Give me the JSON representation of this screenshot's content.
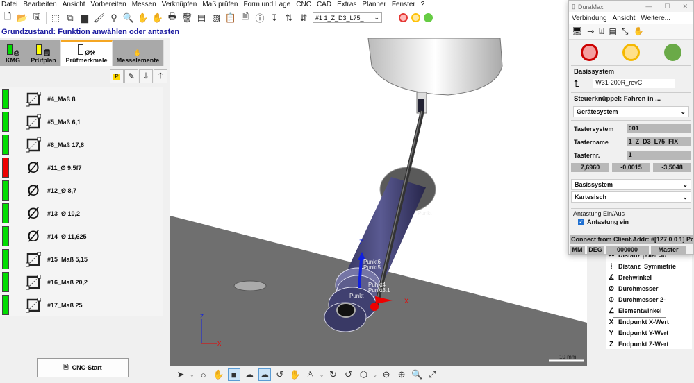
{
  "menu": [
    "Datei",
    "Bearbeiten",
    "Ansicht",
    "Vorbereiten",
    "Messen",
    "Verknüpfen",
    "Maß prüfen",
    "Form und Lage",
    "CNC",
    "CAD",
    "Extras",
    "Planner",
    "Fenster",
    "?"
  ],
  "toolbar": {
    "probe_select": "#1      1_Z_D3_L75_",
    "lights": [
      "#e53935",
      "#ffc107",
      "#4caf50"
    ]
  },
  "status_line": "Grundzustand: Funktion anwählen oder antasten",
  "left_tabs": [
    {
      "label": "KMG",
      "indicator": "#00dd00"
    },
    {
      "label": "Prüfplan",
      "indicator": "#ffff00"
    },
    {
      "label": "Prüfmerkmale",
      "indicator": "#ffffff"
    },
    {
      "label": "Messelemente"
    }
  ],
  "mini_toolbar": {
    "p_label": "P"
  },
  "features": [
    {
      "label": "#4_Maß 8",
      "status": "#00dd00",
      "icon": "distance"
    },
    {
      "label": "#5_Maß 6,1",
      "status": "#00dd00",
      "icon": "distance"
    },
    {
      "label": "#8_Maß 17,8",
      "status": "#00dd00",
      "icon": "distance"
    },
    {
      "label": "#11_Ø 9,5f7",
      "status": "#ee0000",
      "icon": "diameter"
    },
    {
      "label": "#12_Ø 8,7",
      "status": "#00dd00",
      "icon": "diameter"
    },
    {
      "label": "#13_Ø 10,2",
      "status": "#00dd00",
      "icon": "diameter"
    },
    {
      "label": "#14_Ø 11,625",
      "status": "#00dd00",
      "icon": "diameter"
    },
    {
      "label": "#15_Maß 5,15",
      "status": "#00dd00",
      "icon": "distance"
    },
    {
      "label": "#16_Maß 20,2",
      "status": "#00dd00",
      "icon": "distance"
    },
    {
      "label": "#17_Maß 25",
      "status": "#00dd00",
      "icon": "distance"
    }
  ],
  "cnc_start": "CNC-Start",
  "viewport": {
    "labels": {
      "punkt_top": "Punkt",
      "punkt6": "Punkt6",
      "punkt5": "Punkt5",
      "punkt4": "Punkt4",
      "punkt_bottom": "Punkt",
      "punkt31": "Punkt3.1",
      "z": "Z",
      "x": "X",
      "axis_z": "Z",
      "axis_x": "X"
    },
    "scale": "10 mm"
  },
  "feature_types": [
    {
      "icon": "⚯",
      "label": "Distanz polar 3d"
    },
    {
      "icon": "⁞",
      "label": "Distanz_Symmetrie"
    },
    {
      "icon": "∡",
      "label": "Drehwinkel"
    },
    {
      "icon": "Ø",
      "label": "Durchmesser"
    },
    {
      "icon": "⦶",
      "label": "Durchmesser 2-"
    },
    {
      "icon": "∠",
      "label": "Elementwinkel"
    },
    {
      "icon": "X",
      "label": "Endpunkt X-Wert"
    },
    {
      "icon": "Y",
      "label": "Endpunkt Y-Wert"
    },
    {
      "icon": "Z",
      "label": "Endpunkt Z-Wert"
    }
  ],
  "duramax": {
    "title": "DuraMax",
    "menu": [
      "Verbindung",
      "Ansicht",
      "Weitere..."
    ],
    "lights": [
      "#f4a0a0",
      "#ffe08a",
      "#6aaa48"
    ],
    "basissystem_title": "Basissystem",
    "basissystem_value": "W31-200R_revC",
    "joystick_title": "Steuerknüppel: Fahren in ...",
    "joystick_value": "Gerätesystem",
    "tastersystem_label": "Tastersystem",
    "tastersystem": "001",
    "tastername_label": "Tastername",
    "tastername": "1_Z_D3_L75_FIX",
    "tasternr_label": "Tasternr.",
    "tasternr": "1",
    "coords": [
      "7,6960",
      "-0,0015",
      "-3,5048"
    ],
    "coord_system": "Basissystem",
    "coord_type": "Kartesisch",
    "probing_title": "Antastung Ein/Aus",
    "probing_label": "Antastung ein",
    "probing_checked": true,
    "connection": "Connect from Client.Addr: #[127 0 0 1] Po",
    "unit": "MM",
    "angle": "DEG",
    "counter": "000000",
    "mode": "Master"
  }
}
